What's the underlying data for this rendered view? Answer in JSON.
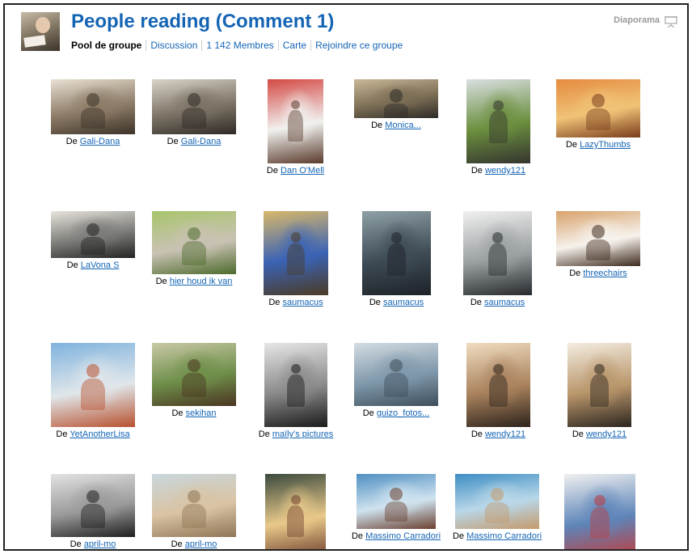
{
  "group": {
    "title": "People reading (Comment 1)",
    "icon": "group-avatar-icon"
  },
  "nav": {
    "items": [
      "Pool de groupe",
      "Discussion",
      "1 142 Membres",
      "Carte",
      "Rejoindre ce groupe"
    ]
  },
  "slideshow": {
    "label": "Diaporama",
    "icon": "slideshow-icon"
  },
  "caption_prefix": "De",
  "colors": {
    "link": "#1565b5",
    "title": "#1565b5",
    "border": "#222222"
  },
  "photos": [
    {
      "author": "Gali-Dana",
      "palette": [
        "#e9e1d4",
        "#8c7b66",
        "#3d332a"
      ]
    },
    {
      "author": "Gali-Dana",
      "palette": [
        "#d8d2c8",
        "#7c7365",
        "#2e2a26"
      ]
    },
    {
      "author": "Dan O'Mell",
      "palette": [
        "#d44a45",
        "#f1f1ef",
        "#5a3b2c"
      ]
    },
    {
      "author": "Monica...",
      "palette": [
        "#c9b898",
        "#7c6e55",
        "#2d2b27"
      ]
    },
    {
      "author": "wendy121",
      "palette": [
        "#d9dfe1",
        "#6b8f3e",
        "#35352f"
      ]
    },
    {
      "author": "LazyThumbs",
      "palette": [
        "#e58b3f",
        "#f0c377",
        "#7a3d1c"
      ]
    },
    {
      "author": "LaVona S",
      "palette": [
        "#e7e4dc",
        "#7b7b78",
        "#222222"
      ]
    },
    {
      "author": "hier houd ik van",
      "palette": [
        "#a8c56b",
        "#c9c2b4",
        "#4d6b2c"
      ]
    },
    {
      "author": "saumacus",
      "palette": [
        "#d9b86a",
        "#3a63b5",
        "#4c3b24"
      ]
    },
    {
      "author": "saumacus",
      "palette": [
        "#8fa0a6",
        "#3e4b55",
        "#1d2228"
      ]
    },
    {
      "author": "saumacus",
      "palette": [
        "#f0f0ef",
        "#9ba0a2",
        "#262a2d"
      ]
    },
    {
      "author": "threechairs",
      "palette": [
        "#d8a26b",
        "#f6f2ec",
        "#3e2a1d"
      ]
    },
    {
      "author": "YetAnotherLisa",
      "palette": [
        "#7fb3de",
        "#e0e6ea",
        "#b8512e"
      ]
    },
    {
      "author": "sekihan",
      "palette": [
        "#c9c8a6",
        "#6f8f4a",
        "#4a3521"
      ]
    },
    {
      "author": "maïly's pictures",
      "palette": [
        "#e6e6e6",
        "#8a8a8a",
        "#1b1b1b"
      ]
    },
    {
      "author": "guizo_fotos...",
      "palette": [
        "#d4dce2",
        "#7f98ab",
        "#3f4e5a"
      ]
    },
    {
      "author": "wendy121",
      "palette": [
        "#f0dcc0",
        "#a9825d",
        "#2d231c"
      ]
    },
    {
      "author": "wendy121",
      "palette": [
        "#f3ece0",
        "#b9966b",
        "#2c2620"
      ]
    },
    {
      "author": "april-mo",
      "palette": [
        "#e3e3e3",
        "#9a9a9a",
        "#1f1f1f"
      ]
    },
    {
      "author": "april-mo",
      "palette": [
        "#c9d7dd",
        "#d9c3a3",
        "#8e7556"
      ]
    },
    {
      "author": "",
      "palette": [
        "#3b4a3e",
        "#e9c98a",
        "#6e3f2e"
      ]
    },
    {
      "author": "Massimo Carradori",
      "palette": [
        "#4f8fc2",
        "#cfe3ef",
        "#6b4030"
      ]
    },
    {
      "author": "Massimo Carradori",
      "palette": [
        "#3d8dc4",
        "#b9d7e8",
        "#c49a6c"
      ]
    },
    {
      "author": "",
      "palette": [
        "#f0f0f0",
        "#5e85b9",
        "#c03d3d"
      ]
    }
  ]
}
